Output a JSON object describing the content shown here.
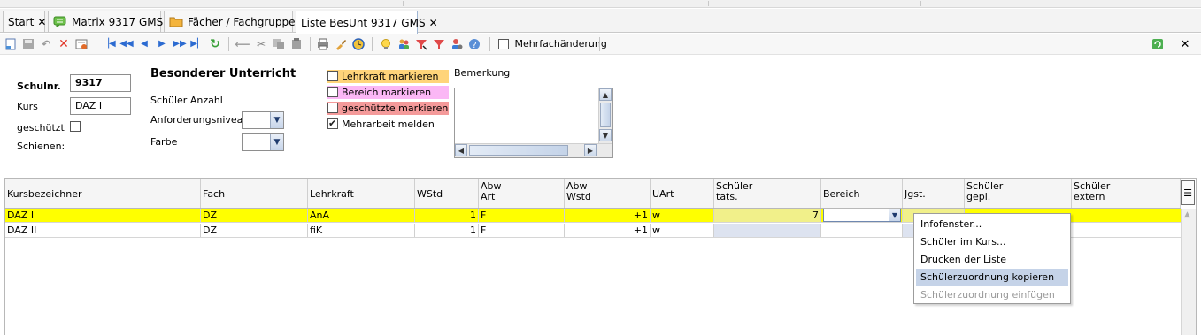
{
  "tabs": [
    {
      "label": "Start",
      "icon": "none",
      "active": false
    },
    {
      "label": "Matrix 9317 GMS",
      "icon": "chat-green-icon",
      "active": false
    },
    {
      "label": "Fächer / Fachgruppen",
      "icon": "folder-icon",
      "active": false
    },
    {
      "label": "Liste BesUnt 9317 GMS",
      "icon": "none",
      "active": true
    }
  ],
  "toolbar": {
    "icons": [
      "new-record-icon",
      "save-icon",
      "undo-icon",
      "delete-icon",
      "properties-icon",
      "first-record-icon",
      "previous-page-icon",
      "previous-record-icon",
      "next-record-icon",
      "next-page-icon",
      "last-record-icon",
      "refresh-icon",
      "back-icon",
      "cut-icon",
      "copy-icon",
      "paste-icon",
      "print-icon",
      "brush-icon",
      "clock-icon",
      "bulb-icon",
      "users-icon",
      "remove-filter-icon",
      "filter-icon",
      "user-settings-icon",
      "help-icon"
    ],
    "mehrfach_label": "Mehrfachänderung",
    "right_icons": [
      "export-icon",
      "close-icon"
    ]
  },
  "form": {
    "schulnr_label": "Schulnr.",
    "schulnr_value": "9317",
    "kurs_label": "Kurs",
    "kurs_value": "DAZ I",
    "geschuetzt_label": "geschützt",
    "schienen_label": "Schienen:",
    "title": "Besonderer Unterricht",
    "schueler_anzahl_label": "Schüler Anzahl",
    "anforderungsniveau_label": "Anforderungsniveau",
    "farbe_label": "Farbe",
    "bemerkung_label": "Bemerkung"
  },
  "markers": [
    {
      "label": "Lehrkraft markieren",
      "color": "#ffd47a",
      "checked": false
    },
    {
      "label": "Bereich markieren",
      "color": "#fbb7f5",
      "checked": false
    },
    {
      "label": "geschützte markieren",
      "color": "#f49a9a",
      "checked": false
    },
    {
      "label": "Mehrarbeit melden",
      "color": "",
      "checked": true
    }
  ],
  "grid": {
    "headers": [
      {
        "line1": "Kursbezeichner",
        "line2": ""
      },
      {
        "line1": "Fach",
        "line2": ""
      },
      {
        "line1": "Lehrkraft",
        "line2": ""
      },
      {
        "line1": "WStd",
        "line2": ""
      },
      {
        "line1": "Abw",
        "line2": "Art"
      },
      {
        "line1": "Abw",
        "line2": "Wstd"
      },
      {
        "line1": "UArt",
        "line2": ""
      },
      {
        "line1": "Schüler",
        "line2": "tats."
      },
      {
        "line1": "Bereich",
        "line2": ""
      },
      {
        "line1": "Jgst.",
        "line2": ""
      },
      {
        "line1": "Schüler",
        "line2": "gepl."
      },
      {
        "line1": "Schüler",
        "line2": "extern"
      }
    ],
    "rows": [
      {
        "kurs": "DAZ I",
        "fach": "DZ",
        "lehrkraft": "AnA",
        "wstd": "1",
        "abw_art": "F",
        "abw_wstd": "+1",
        "uart": "w",
        "schueler_tats": "7",
        "bereich": "",
        "jgst": "",
        "selected": true
      },
      {
        "kurs": "DAZ II",
        "fach": "DZ",
        "lehrkraft": "fiK",
        "wstd": "1",
        "abw_art": "F",
        "abw_wstd": "+1",
        "uart": "w",
        "schueler_tats": "",
        "bereich": "",
        "jgst": "",
        "selected": false
      }
    ]
  },
  "context_menu": [
    {
      "label": "Infofenster...",
      "highlighted": false,
      "disabled": false
    },
    {
      "label": "Schüler im Kurs...",
      "highlighted": false,
      "disabled": false
    },
    {
      "label": "Drucken der Liste",
      "highlighted": false,
      "disabled": false
    },
    {
      "label": "Schülerzuordnung kopieren",
      "highlighted": true,
      "disabled": false
    },
    {
      "label": "Schülerzuordnung einfügen",
      "highlighted": false,
      "disabled": true
    }
  ]
}
